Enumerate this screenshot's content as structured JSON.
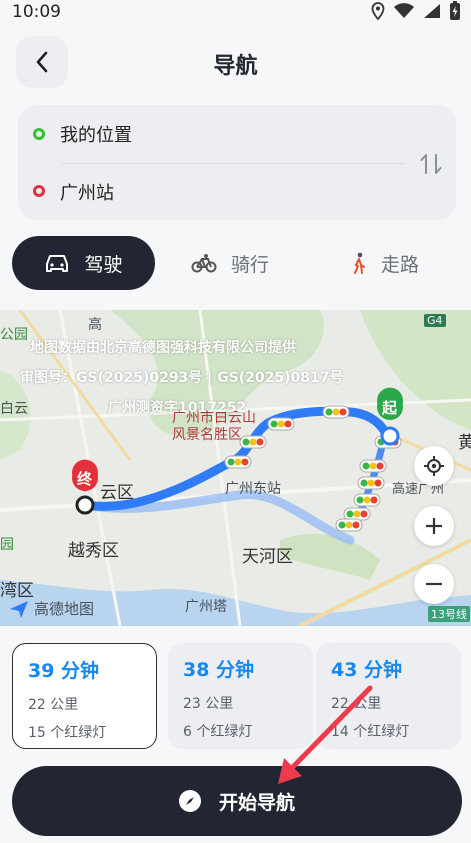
{
  "status_bar": {
    "time": "10:09"
  },
  "header": {
    "title": "导航"
  },
  "route": {
    "origin": "我的位置",
    "destination": "广州站",
    "origin_color": "#35c12f",
    "destination_color": "#e3303a"
  },
  "modes": [
    {
      "label": "驾驶",
      "icon": "car-icon",
      "active": true
    },
    {
      "label": "骑行",
      "icon": "bicycle-icon",
      "active": false
    },
    {
      "label": "走路",
      "icon": "walking-icon",
      "active": false
    }
  ],
  "map": {
    "watermark_lines": [
      "地图数据由北京高德图强科技有限公司提供",
      "审图号：GS(2025)0293号 | GS(2025)0817号",
      "广州测资字1017252"
    ],
    "start_marker": "起",
    "end_marker": "终",
    "labels": {
      "baiyun_district": "云区",
      "yuexiu_district": "越秀区",
      "tianhe_district": "天河区",
      "baiyun_scenic": "广州市白云山\n风景名胜区",
      "guangzhou_east_station": "广州东站",
      "canton_tower": "广州塔",
      "park": "公园",
      "gao": "高",
      "baiyun_abbr": "白云",
      "wan_district": "湾区",
      "huang": "黄",
      "park_left": "园",
      "highway_text": "高速广州",
      "road_g4": "G4",
      "road_13": "13号线",
      "amap_logo": "高德地图"
    },
    "colors": {
      "route": "#2f7cf6",
      "traffic_green": "#3ab54a",
      "traffic_yellow": "#f7c21b",
      "traffic_red": "#e8412f"
    }
  },
  "route_options": [
    {
      "time": "39 分钟",
      "distance": "22 公里",
      "lights": "15 个红绿灯",
      "selected": true
    },
    {
      "time": "38 分钟",
      "distance": "23 公里",
      "lights": "6 个红绿灯",
      "selected": false
    },
    {
      "time": "43 分钟",
      "distance": "22 公里",
      "lights": "14 个红绿灯",
      "selected": false
    }
  ],
  "start_button": {
    "label": "开始导航"
  },
  "accent_color": "#1689f0"
}
